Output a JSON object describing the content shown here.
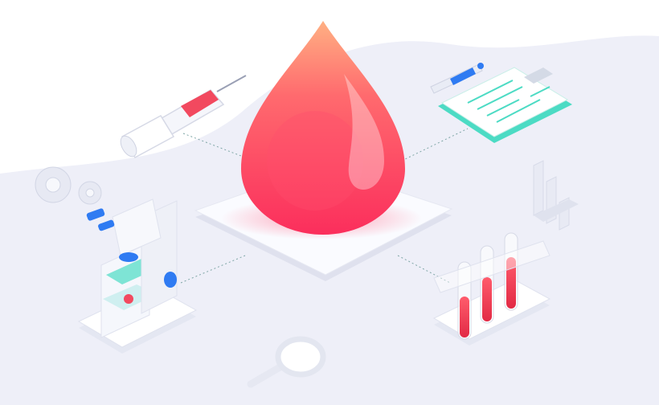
{
  "scene": {
    "subject": "blood-test-illustration",
    "colors": {
      "background_light": "#eeeff8",
      "background_white": "#ffffff",
      "blood_red": "#fb3562",
      "blood_orange": "#ffa382",
      "accent_teal": "#4cdbc4",
      "accent_blue": "#2f7bf2",
      "platform": "#f7f8fc",
      "outline": "#dfe1ee"
    },
    "icons": [
      "blood-drop-icon",
      "syringe-icon",
      "clipboard-icon",
      "pen-icon",
      "gear-icon",
      "microscope-icon",
      "bar-chart-icon",
      "test-tube-rack-icon",
      "magnifier-icon"
    ],
    "test_tube_fill_levels": [
      0.55,
      0.6,
      0.7
    ]
  }
}
